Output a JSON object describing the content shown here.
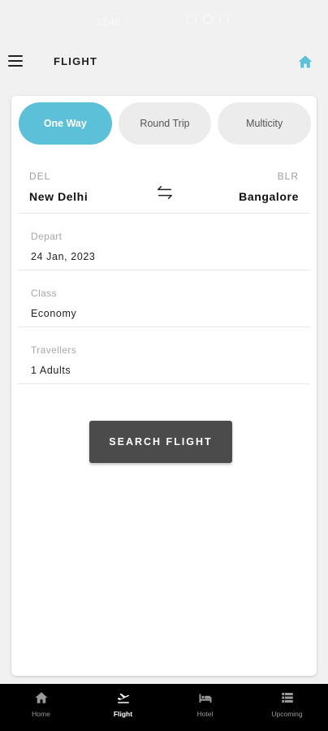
{
  "status_bar": {
    "time": "12:46"
  },
  "app_bar": {
    "title": "FLIGHT",
    "menu_icon": "hamburger-menu-icon",
    "home_icon": "home-icon",
    "accent_color": "#5bc0d8"
  },
  "trip_tabs": [
    {
      "label": "One Way",
      "active": true
    },
    {
      "label": "Round Trip",
      "active": false
    },
    {
      "label": "Multicity",
      "active": false
    }
  ],
  "route": {
    "from_code": "DEL",
    "from_city": "New Delhi",
    "to_code": "BLR",
    "to_city": "Bangalore",
    "swap_icon": "swap-arrows-icon"
  },
  "depart": {
    "label": "Depart",
    "value": "24 Jan, 2023"
  },
  "class": {
    "label": "Class",
    "value": "Economy"
  },
  "travellers": {
    "label": "Travellers",
    "value": "1 Adults"
  },
  "search_button": {
    "label": "SEARCH FLIGHT",
    "color": "#4b4b4b"
  },
  "bottom_nav": [
    {
      "label": "Home",
      "icon": "home-icon",
      "active": false
    },
    {
      "label": "Flight",
      "icon": "flight-takeoff-icon",
      "active": true
    },
    {
      "label": "Hotel",
      "icon": "bed-icon",
      "active": false
    },
    {
      "label": "Upcoming",
      "icon": "list-icon",
      "active": false
    }
  ]
}
